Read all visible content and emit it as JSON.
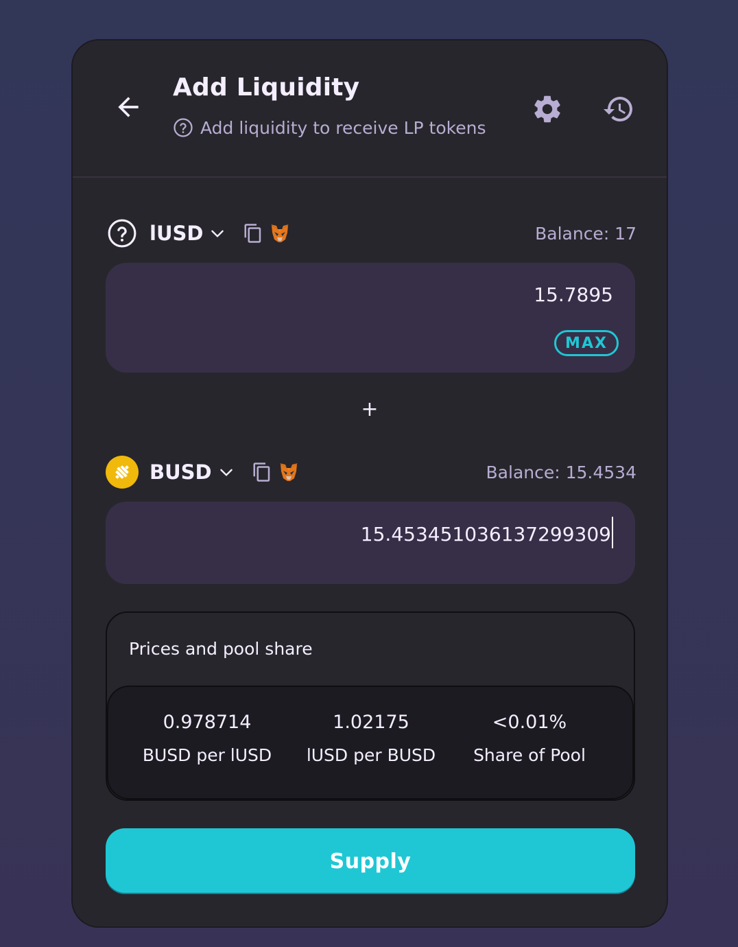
{
  "header": {
    "title": "Add Liquidity",
    "subtitle": "Add liquidity to receive LP tokens"
  },
  "token_a": {
    "symbol": "lUSD",
    "balance": "Balance: 17",
    "amount": "15.7895",
    "max_label": "MAX",
    "logo_icon": "question-circle-icon"
  },
  "separator": "+",
  "token_b": {
    "symbol": "BUSD",
    "balance": "Balance: 15.4534",
    "amount": "15.453451036137299309",
    "logo_icon": "busd-logo-icon"
  },
  "pool": {
    "title": "Prices and pool share",
    "stats": [
      {
        "value": "0.978714",
        "label": "BUSD per lUSD"
      },
      {
        "value": "1.02175",
        "label": "lUSD per BUSD"
      },
      {
        "value": "<0.01%",
        "label": "Share of Pool"
      }
    ]
  },
  "supply_label": "Supply",
  "colors": {
    "accent": "#1fc7d4",
    "card": "#27262c",
    "input": "#372f47",
    "text_secondary": "#b8add2",
    "busd_yellow": "#f0b90b"
  }
}
